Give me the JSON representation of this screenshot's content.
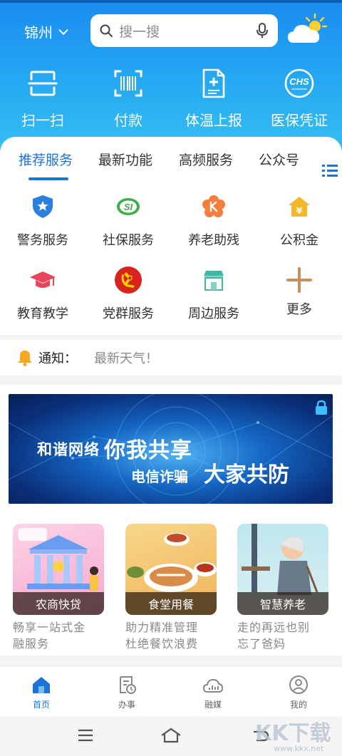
{
  "header": {
    "city": "锦州",
    "search_placeholder": "搜一搜"
  },
  "quick_actions": [
    {
      "label": "扫一扫",
      "icon": "scan-icon"
    },
    {
      "label": "付款",
      "icon": "barcode-icon"
    },
    {
      "label": "体温上报",
      "icon": "medical-report-icon"
    },
    {
      "label": "医保凭证",
      "icon": "chs-icon"
    }
  ],
  "tabs": [
    {
      "label": "推荐服务",
      "active": true
    },
    {
      "label": "最新功能",
      "active": false
    },
    {
      "label": "高频服务",
      "active": false
    },
    {
      "label": "公众号",
      "active": false
    }
  ],
  "services": [
    {
      "label": "警务服务",
      "icon": "police-shield-icon"
    },
    {
      "label": "社保服务",
      "icon": "social-security-icon"
    },
    {
      "label": "养老助残",
      "icon": "elderly-care-icon"
    },
    {
      "label": "公积金",
      "icon": "housing-fund-icon"
    },
    {
      "label": "教育教学",
      "icon": "graduation-cap-icon"
    },
    {
      "label": "党群服务",
      "icon": "party-emblem-icon"
    },
    {
      "label": "周边服务",
      "icon": "storefront-icon"
    },
    {
      "label": "更多",
      "icon": "plus-icon"
    }
  ],
  "notice": {
    "label": "通知：",
    "text": "最新天气！"
  },
  "banner": {
    "line1_a": "和谐网络",
    "line1_b": "你我共享",
    "line2_a": "电信诈骗",
    "line2_b": "大家共防"
  },
  "features": [
    {
      "caption": "农商快贷",
      "desc_line1": "畅享一站式金",
      "desc_line2": "融服务"
    },
    {
      "caption": "食堂用餐",
      "desc_line1": "助力精准管理",
      "desc_line2": "杜绝餐饮浪费"
    },
    {
      "caption": "智慧养老",
      "desc_line1": "走的再远也别",
      "desc_line2": "忘了爸妈"
    }
  ],
  "bottom_nav": [
    {
      "label": "首页",
      "active": true
    },
    {
      "label": "办事",
      "active": false
    },
    {
      "label": "融媒",
      "active": false
    },
    {
      "label": "我的",
      "active": false
    }
  ],
  "watermark": {
    "main": "KK下载",
    "sub": "www.kkx.net"
  },
  "colors": {
    "accent": "#1b74d8",
    "header_top": "#1a8cf0",
    "header_bottom": "#35c0f3"
  }
}
